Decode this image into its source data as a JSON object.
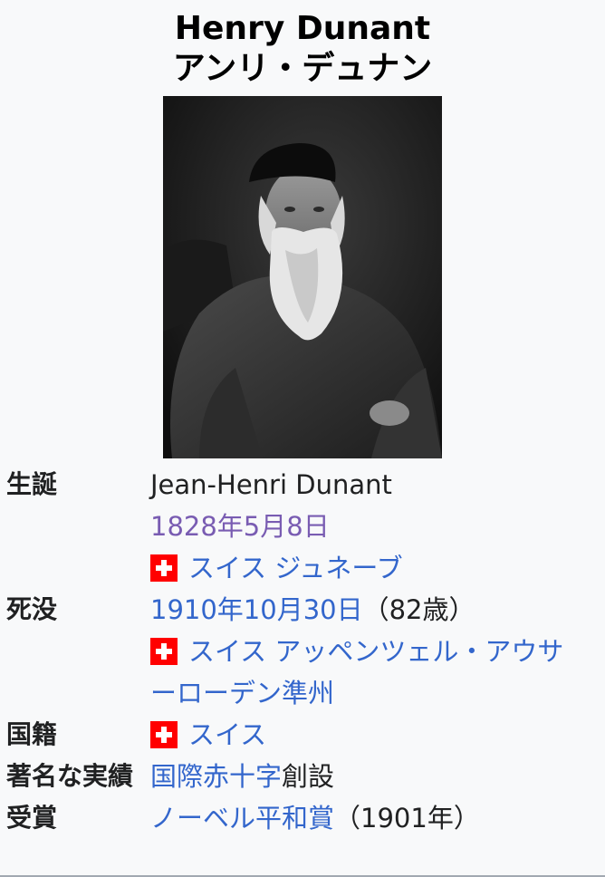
{
  "title": {
    "latin": "Henry Dunant",
    "japanese": "アンリ・デュナン"
  },
  "rows": {
    "birth": {
      "label": "生誕",
      "name": "Jean-Henri Dunant",
      "date": "1828年5月8日",
      "country": "スイス",
      "place": "ジュネーブ"
    },
    "death": {
      "label": "死没",
      "date": "1910年10月30日",
      "age": "（82歳）",
      "country": "スイス",
      "place_part1": "アッペンツェル・アウサ",
      "place_part2": "ーローデン準州"
    },
    "nationality": {
      "label": "国籍",
      "country": "スイス"
    },
    "known_for": {
      "label": "著名な実績",
      "link": "国際赤十字",
      "suffix": "創設"
    },
    "awards": {
      "label": "受賞",
      "link": "ノーベル平和賞",
      "suffix": "（1901年）"
    }
  },
  "colors": {
    "link": "#3366cc",
    "visited_link": "#795cb2",
    "background": "#f8f9fa",
    "flag_red": "#ff0000"
  },
  "icons": [
    "swiss-flag-icon"
  ]
}
